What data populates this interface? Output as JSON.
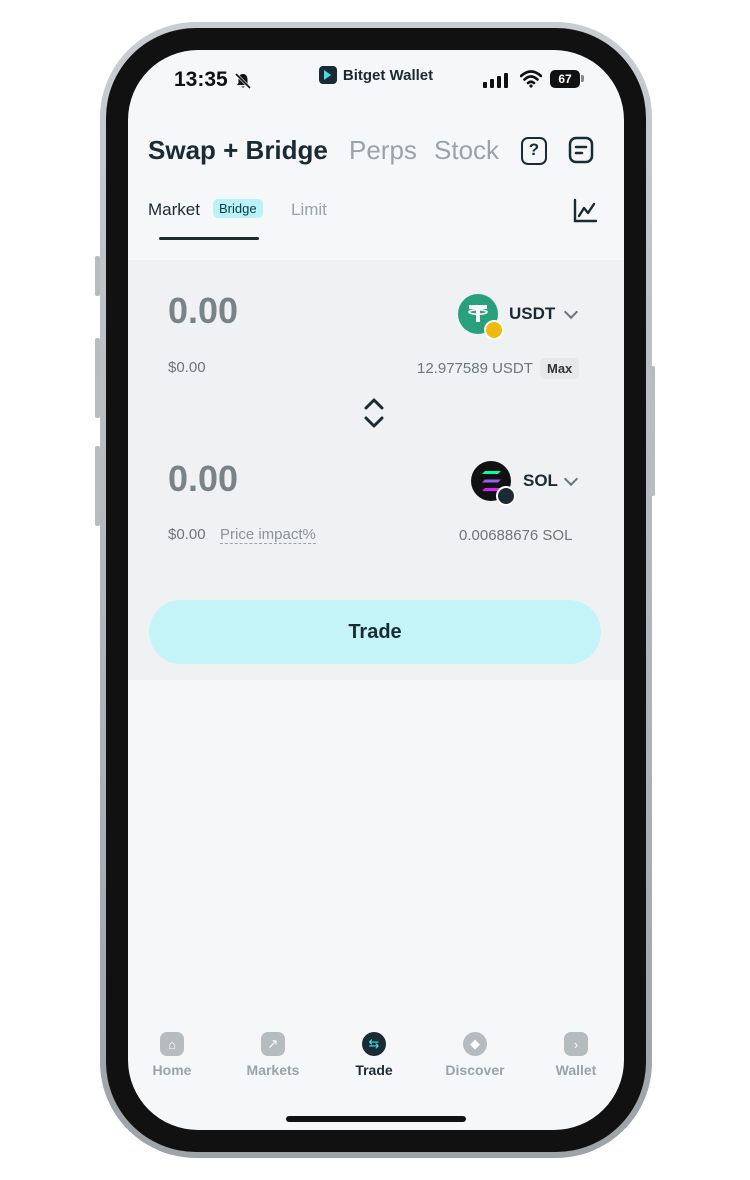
{
  "status": {
    "time": "13:35",
    "app_name": "Bitget Wallet",
    "battery": "67"
  },
  "header": {
    "tabs": [
      {
        "label": "Swap + Bridge",
        "active": true
      },
      {
        "label": "Perps",
        "active": false
      },
      {
        "label": "Stock",
        "active": false
      }
    ]
  },
  "subtabs": {
    "market": "Market",
    "bridge_badge": "Bridge",
    "limit": "Limit"
  },
  "swap": {
    "from": {
      "amount": "0.00",
      "usd": "$0.00",
      "token": "USDT",
      "balance": "12.977589 USDT",
      "max_label": "Max"
    },
    "to": {
      "amount": "0.00",
      "usd": "$0.00",
      "price_impact": "Price impact%",
      "token": "SOL",
      "balance": "0.00688676 SOL"
    },
    "trade_label": "Trade"
  },
  "nav": {
    "items": [
      {
        "label": "Home",
        "icon": "home-icon",
        "active": false
      },
      {
        "label": "Markets",
        "icon": "markets-icon",
        "active": false
      },
      {
        "label": "Trade",
        "icon": "trade-icon",
        "active": true
      },
      {
        "label": "Discover",
        "icon": "discover-icon",
        "active": false
      },
      {
        "label": "Wallet",
        "icon": "wallet-icon",
        "active": false
      }
    ]
  },
  "colors": {
    "accent": "#3ee0f0",
    "trade_button": "#c4f3f8",
    "text_dark": "#1b2b33"
  }
}
